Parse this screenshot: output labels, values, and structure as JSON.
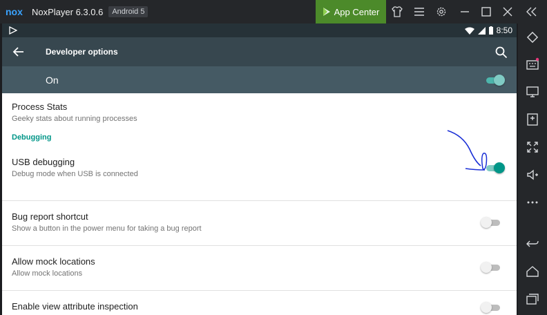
{
  "window": {
    "app_name": "NoxPlayer 6.3.0.6",
    "android_badge": "Android 5",
    "app_center_label": "App Center"
  },
  "titlebar_icons": [
    "shirt-icon",
    "menu-icon",
    "gear-icon",
    "minimize-icon",
    "maximize-icon",
    "close-icon",
    "collapse-icon"
  ],
  "sidebar_icons": [
    "rotate-icon",
    "keyboard-icon",
    "screen-icon",
    "apk-icon",
    "fullscreen-icon",
    "volume-icon",
    "more-icon",
    "back-icon",
    "home-icon",
    "recents-icon"
  ],
  "statusbar": {
    "time": "8:50"
  },
  "appbar": {
    "title": "Developer options"
  },
  "master_switch": {
    "label": "On",
    "state": "on"
  },
  "settings": {
    "process_stats": {
      "title": "Process Stats",
      "subtitle": "Geeky stats about running processes"
    },
    "debugging_header": "Debugging",
    "usb_debugging": {
      "title": "USB debugging",
      "subtitle": "Debug mode when USB is connected",
      "state": "on"
    },
    "bug_report": {
      "title": "Bug report shortcut",
      "subtitle": "Show a button in the power menu for taking a bug report",
      "state": "off"
    },
    "mock_locations": {
      "title": "Allow mock locations",
      "subtitle": "Allow mock locations",
      "state": "off"
    },
    "view_attribute": {
      "title": "Enable view attribute inspection",
      "state": "off"
    }
  },
  "colors": {
    "titlebar": "#25272a",
    "app_center": "#4c8a2a",
    "statusbar": "#263238",
    "appbar": "#37474f",
    "onbar": "#455a64",
    "accent": "#009688",
    "annotation": "#1a2fd6"
  }
}
